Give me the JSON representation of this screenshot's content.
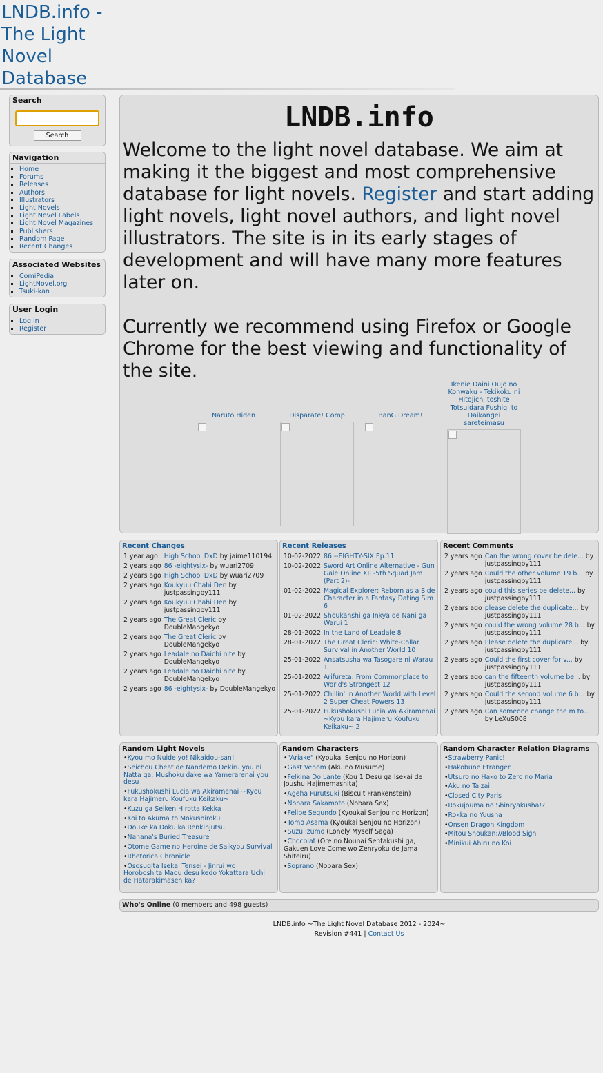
{
  "header": {
    "logo_alt": "LNDB.info - The Light Novel Database"
  },
  "sidebar": {
    "search": {
      "title": "Search",
      "button": "Search",
      "value": ""
    },
    "navigation": {
      "title": "Navigation",
      "items": [
        "Home",
        "Forums",
        "Releases",
        "Authors",
        "Illustrators",
        "Light Novels",
        "Light Novel Labels",
        "Light Novel Magazines",
        "Publishers",
        "Random Page",
        "Recent Changes"
      ]
    },
    "associated": {
      "title": "Associated Websites",
      "items": [
        "ComiPedia",
        "LightNovel.org",
        "Tsuki-kan"
      ]
    },
    "login": {
      "title": "User Login",
      "items": [
        "Log in",
        "Register"
      ]
    }
  },
  "main": {
    "title": "LNDB.info",
    "intro_before_link": "Welcome to the light novel database. We aim at making it the biggest and most comprehensive database for light novels. ",
    "intro_link": "Register",
    "intro_after_link": " and start adding light novels, light novel authors, and light novel illustrators. The site is in its early stages of development and will have many more features later on.",
    "recommend": "Currently we recommend using Firefox or Google Chrome for the best viewing and functionality of the site.",
    "covers": [
      {
        "title": "Naruto Hiden"
      },
      {
        "title": "Disparate! Comp"
      },
      {
        "title": "BanG Dream!"
      },
      {
        "title": "Ikenie Daini Oujo no Konwaku - Tekikoku ni Hitojichi toshite Totsuidara Fushigi to Daikangei sareteimasu"
      }
    ]
  },
  "recent_changes": {
    "title": "Recent Changes",
    "rows": [
      {
        "time": "1 year ago",
        "link": "High School DxD",
        "by": "by jaime110194"
      },
      {
        "time": "2 years ago",
        "link": "86 -eightysix-",
        "by": "by wuari2709"
      },
      {
        "time": "2 years ago",
        "link": "High School DxD",
        "by": "by wuari2709"
      },
      {
        "time": "2 years ago",
        "link": "Koukyuu Chahi Den",
        "by": "by justpassingby111"
      },
      {
        "time": "2 years ago",
        "link": "Koukyuu Chahi Den",
        "by": "by justpassingby111"
      },
      {
        "time": "2 years ago",
        "link": "The Great Cleric",
        "by": "by DoubleMangekyo"
      },
      {
        "time": "2 years ago",
        "link": "The Great Cleric",
        "by": "by DoubleMangekyo"
      },
      {
        "time": "2 years ago",
        "link": "Leadale no Daichi nite",
        "by": "by DoubleMangekyo"
      },
      {
        "time": "2 years ago",
        "link": "Leadale no Daichi nite",
        "by": "by DoubleMangekyo"
      },
      {
        "time": "2 years ago",
        "link": "86 -eightysix-",
        "by": "by DoubleMangekyo"
      }
    ]
  },
  "recent_releases": {
    "title": "Recent Releases",
    "rows": [
      {
        "date": "10-02-2022",
        "title": "86 --EIGHTY-SIX Ep.11"
      },
      {
        "date": "10-02-2022",
        "title": "Sword Art Online Alternative - Gun Gale Online XII -5th Squad Jam (Part 2)-"
      },
      {
        "date": "01-02-2022",
        "title": "Magical Explorer: Reborn as a Side Character in a Fantasy Dating Sim 6"
      },
      {
        "date": "01-02-2022",
        "title": "Shoukanshi ga Inkya de Nani ga Warui 1"
      },
      {
        "date": "28-01-2022",
        "title": "In the Land of Leadale 8"
      },
      {
        "date": "28-01-2022",
        "title": "The Great Cleric: White-Collar Survival in Another World 10"
      },
      {
        "date": "25-01-2022",
        "title": "Ansatsusha wa Tasogare ni Warau 1"
      },
      {
        "date": "25-01-2022",
        "title": "Arifureta: From Commonplace to World's Strongest 12"
      },
      {
        "date": "25-01-2022",
        "title": "Chillin' in Another World with Level 2 Super Cheat Powers 13"
      },
      {
        "date": "25-01-2022",
        "title": "Fukushokushi Lucia wa Akiramenai ~Kyou kara Hajimeru Koufuku Keikaku~ 2"
      }
    ]
  },
  "recent_comments": {
    "title": "Recent Comments",
    "rows": [
      {
        "time": "2 years ago",
        "link": "Can the wrong cover be dele...",
        "by": "by justpassingby111"
      },
      {
        "time": "2 years ago",
        "link": "Could the other volume 19 b...",
        "by": "by justpassingby111"
      },
      {
        "time": "2 years ago",
        "link": "could this series be delete...",
        "by": "by justpassingby111"
      },
      {
        "time": "2 years ago",
        "link": "please delete the duplicate...",
        "by": "by justpassingby111"
      },
      {
        "time": "2 years ago",
        "link": "could the wrong volume 28 b...",
        "by": "by justpassingby111"
      },
      {
        "time": "2 years ago",
        "link": "Please delete the duplicate...",
        "by": "by justpassingby111"
      },
      {
        "time": "2 years ago",
        "link": "Could the first cover for v...",
        "by": "by justpassingby111"
      },
      {
        "time": "2 years ago",
        "link": "can the fifteenth volume be...",
        "by": "by justpassingby111"
      },
      {
        "time": "2 years ago",
        "link": "Could the second volume 6 b...",
        "by": "by justpassingby111"
      },
      {
        "time": "2 years ago",
        "link": "Can someone change the m to...",
        "by": "by LeXuS008"
      }
    ]
  },
  "random_light_novels": {
    "title": "Random Light Novels",
    "items": [
      "Kyou mo Nuide yo! Nikaidou-san!",
      "Seichou Cheat de Nandemo Dekiru you ni Natta ga, Mushoku dake wa Yamerarenai you desu",
      "Fukushokushi Lucia wa Akiramenai ~Kyou kara Hajimeru Koufuku Keikaku~",
      "Kuzu ga Seiken Hirotta Kekka",
      "Koi to Akuma to Mokushiroku",
      "Douke ka Doku ka Renkinjutsu",
      "Nanana's Buried Treasure",
      "Otome Game no Heroine de Saikyou Survival",
      "Rhetorica Chronicle",
      "Ososugita Isekai Tensei - Jinrui wo Horoboshita Maou desu kedo Yokattara Uchi de Hatarakimasen ka?"
    ]
  },
  "random_characters": {
    "title": "Random Characters",
    "items": [
      {
        "name": "\"Ariake\"",
        "series": " (Kyoukai Senjou no Horizon)"
      },
      {
        "name": "Gast Venom",
        "series": " (Aku no Musume)"
      },
      {
        "name": "Felkina Do Lante",
        "series": " (Kou 1 Desu ga Isekai de Joushu Hajimemashita)"
      },
      {
        "name": "Ageha Furutsuki",
        "series": " (Biscuit Frankenstein)"
      },
      {
        "name": "Nobara Sakamoto",
        "series": " (Nobara Sex)"
      },
      {
        "name": "Felipe Segundo",
        "series": " (Kyoukai Senjou no Horizon)"
      },
      {
        "name": "Tomo Asama",
        "series": " (Kyoukai Senjou no Horizon)"
      },
      {
        "name": "Suzu Izumo",
        "series": " (Lonely Myself Saga)"
      },
      {
        "name": "Chocolat",
        "series": " (Ore no Nounai Sentakushi ga, Gakuen Love Come wo Zenryoku de Jama Shiteiru)"
      },
      {
        "name": "Soprano",
        "series": " (Nobara Sex)"
      }
    ]
  },
  "random_diagrams": {
    "title": "Random Character Relation Diagrams",
    "items": [
      "Strawberry Panic!",
      "Hakobune Etranger",
      "Utsuro no Hako to Zero no Maria",
      "Aku no Taizai",
      "Closed City Paris",
      "Rokujouma no Shinryakusha!?",
      "Rokka no Yuusha",
      "Onsen Dragon Kingdom",
      "Mitou Shoukan://Blood Sign",
      "Minikui Ahiru no Koi"
    ]
  },
  "whos_online": {
    "label": "Who's Online",
    "detail": " (0 members and 498 guests)"
  },
  "footer": {
    "line1": "LNDB.info ~The Light Novel Database 2012 - 2024~",
    "revision": "Revision #441 | ",
    "contact": "Contact Us"
  }
}
